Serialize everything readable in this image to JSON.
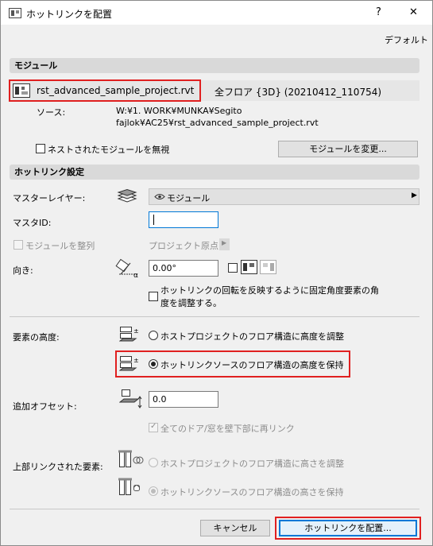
{
  "window": {
    "title": "ホットリンクを配置",
    "help": "?",
    "close": "✕"
  },
  "toolbar": {
    "default_label": "デフォルト"
  },
  "module": {
    "header": "モジュール",
    "file_name": "rst_advanced_sample_project.rvt",
    "story_info": "全フロア {3D} (20210412_110754)",
    "source_label": "ソース:",
    "source_path_line1": "W:¥1. WORK¥MUNKA¥Segito",
    "source_path_line2": "fajlok¥AC25¥rst_advanced_sample_project.rvt",
    "ignore_nested_label": "ネストされたモジュールを無視",
    "change_button": "モジュールを変更..."
  },
  "hotlink_settings": {
    "header": "ホットリンク設定",
    "master_layer_label": "マスターレイヤー:",
    "master_layer_value": "モジュール",
    "master_id_label": "マスタID:",
    "master_id_value": "",
    "align_module_label": "モジュールを整列",
    "project_origin_label": "プロジェクト原点",
    "orientation_label": "向き:",
    "orientation_value": "0.00°",
    "rotation_fixed_line1": "ホットリンクの回転を反映するように固定角度要素の角",
    "rotation_fixed_line2": "度を調整する。"
  },
  "elevation": {
    "label": "要素の高度:",
    "option_host": "ホストプロジェクトのフロア構造に高度を調整",
    "option_source": "ホットリンクソースのフロア構造の高度を保持"
  },
  "offset": {
    "label": "追加オフセット:",
    "value": "0.0",
    "relink_doors_label": "全てのドア/窓を壁下部に再リンク"
  },
  "top_linked": {
    "label": "上部リンクされた要素:",
    "option_host": "ホストプロジェクトのフロア構造に高さを調整",
    "option_source": "ホットリンクソースのフロア構造の高さを保持"
  },
  "footer": {
    "cancel_button": "キャンセル",
    "place_button": "ホットリンクを配置..."
  },
  "colors": {
    "highlight": "#e02020",
    "section": "#d9d9d9",
    "dialog_bg": "#f0f0f0"
  }
}
